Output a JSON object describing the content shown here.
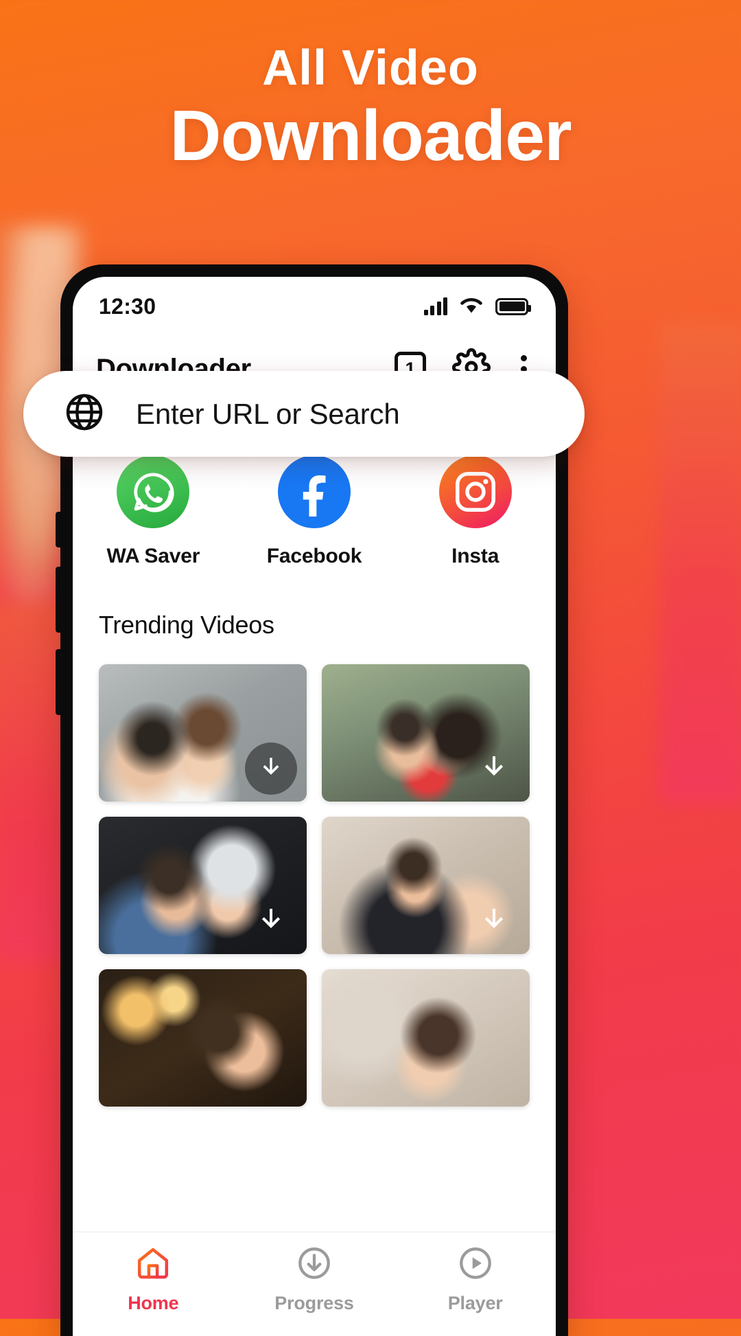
{
  "hero": {
    "line1": "All Video",
    "line2": "Downloader"
  },
  "theme": {
    "gradient_start": "#F97316",
    "gradient_end": "#F2395C",
    "accent": "#F0354F",
    "inactive": "#9B9B9B"
  },
  "phone": {
    "statusbar": {
      "time": "12:30",
      "signal_icon": "signal-bars-icon",
      "wifi_icon": "wifi-icon",
      "battery_icon": "battery-full-icon"
    },
    "appbar": {
      "title": "Downloader",
      "tab_count": "1",
      "settings_icon": "gear-icon",
      "overflow_icon": "more-vertical-icon"
    },
    "search": {
      "icon": "globe-icon",
      "placeholder": "Enter URL or Search",
      "value": ""
    },
    "shortcuts": [
      {
        "id": "wa",
        "label": "WA Saver",
        "icon": "whatsapp-icon",
        "color": "#27A93C"
      },
      {
        "id": "fb",
        "label": "Facebook",
        "icon": "facebook-icon",
        "color": "#1877F2"
      },
      {
        "id": "ig",
        "label": "Insta",
        "icon": "instagram-icon",
        "color": "#E91E63"
      }
    ],
    "trending": {
      "title": "Trending Videos",
      "items": [
        {
          "id": "v1",
          "thumb_class": "t1",
          "download_icon": "download-arrow-icon",
          "badge_style": "circle"
        },
        {
          "id": "v2",
          "thumb_class": "t2",
          "download_icon": "download-arrow-icon",
          "badge_style": "plain"
        },
        {
          "id": "v3",
          "thumb_class": "t3",
          "download_icon": "download-arrow-icon",
          "badge_style": "plain"
        },
        {
          "id": "v4",
          "thumb_class": "t4",
          "download_icon": "download-arrow-icon",
          "badge_style": "plain"
        },
        {
          "id": "v5",
          "thumb_class": "t5",
          "download_icon": "",
          "badge_style": "none"
        },
        {
          "id": "v6",
          "thumb_class": "t6",
          "download_icon": "",
          "badge_style": "none"
        }
      ]
    },
    "bottom_nav": [
      {
        "id": "home",
        "label": "Home",
        "icon": "home-icon",
        "active": true
      },
      {
        "id": "progress",
        "label": "Progress",
        "icon": "download-circle-icon",
        "active": false
      },
      {
        "id": "player",
        "label": "Player",
        "icon": "play-circle-icon",
        "active": false
      }
    ]
  }
}
